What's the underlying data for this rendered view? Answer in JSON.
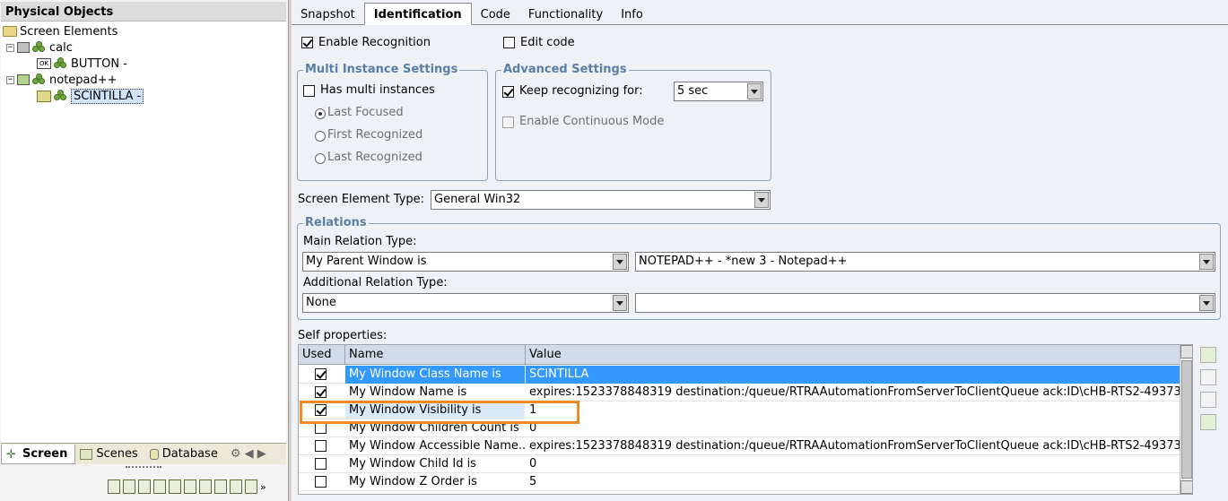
{
  "left_panel": {
    "title": "Physical Objects",
    "tree": [
      {
        "label": "Screen Elements"
      },
      {
        "label": "calc"
      },
      {
        "label": "BUTTON -"
      },
      {
        "label": "notepad++"
      },
      {
        "label": "SCINTILLA -"
      }
    ],
    "bottom_tabs": [
      "Screen",
      "Scenes",
      "Database"
    ]
  },
  "tabs": [
    "Snapshot",
    "Identification",
    "Code",
    "Functionality",
    "Info"
  ],
  "identification": {
    "enable_recognition": {
      "label": "Enable Recognition",
      "checked": true
    },
    "edit_code": {
      "label": "Edit code",
      "checked": false
    },
    "multi_instance": {
      "title": "Multi Instance Settings",
      "has_multi": {
        "label": "Has multi instances",
        "checked": false
      },
      "options": [
        "Last Focused",
        "First Recognized",
        "Last Recognized"
      ],
      "selected": "Last Focused"
    },
    "advanced": {
      "title": "Advanced Settings",
      "keep_recognizing": {
        "label": "Keep recognizing for:",
        "checked": true
      },
      "duration": "5 sec",
      "continuous": {
        "label": "Enable Continuous Mode",
        "checked": false
      }
    },
    "screen_element_type": {
      "label": "Screen Element Type:",
      "value": "General Win32"
    },
    "relations": {
      "title": "Relations",
      "main_label": "Main Relation Type:",
      "main_type": "My Parent Window is",
      "main_target": "NOTEPAD++ - *new 3 - Notepad++",
      "additional_label": "Additional Relation Type:",
      "additional_type": "None",
      "additional_target": ""
    },
    "self_properties": {
      "label": "Self properties:",
      "columns": [
        "Used",
        "Name",
        "Value"
      ],
      "rows": [
        {
          "used": true,
          "name": "My Window Class Name is",
          "value": "SCINTILLA"
        },
        {
          "used": true,
          "name": "My Window Name is",
          "value": "expires:1523378848319 destination:/queue/RTRAAutomationFromServerToClientQueue ack:ID\\cHB-RTS2-49373..."
        },
        {
          "used": true,
          "name": "My Window Visibility is",
          "value": "1"
        },
        {
          "used": false,
          "name": "My Window Children Count is",
          "value": "0"
        },
        {
          "used": false,
          "name": "My Window Accessible Name...",
          "value": "expires:1523378848319 destination:/queue/RTRAAutomationFromServerToClientQueue ack:ID\\cHB-RTS2-49373..."
        },
        {
          "used": false,
          "name": "My Window Child Id is",
          "value": "0"
        },
        {
          "used": false,
          "name": "My Window Z Order is",
          "value": "5"
        }
      ]
    }
  }
}
